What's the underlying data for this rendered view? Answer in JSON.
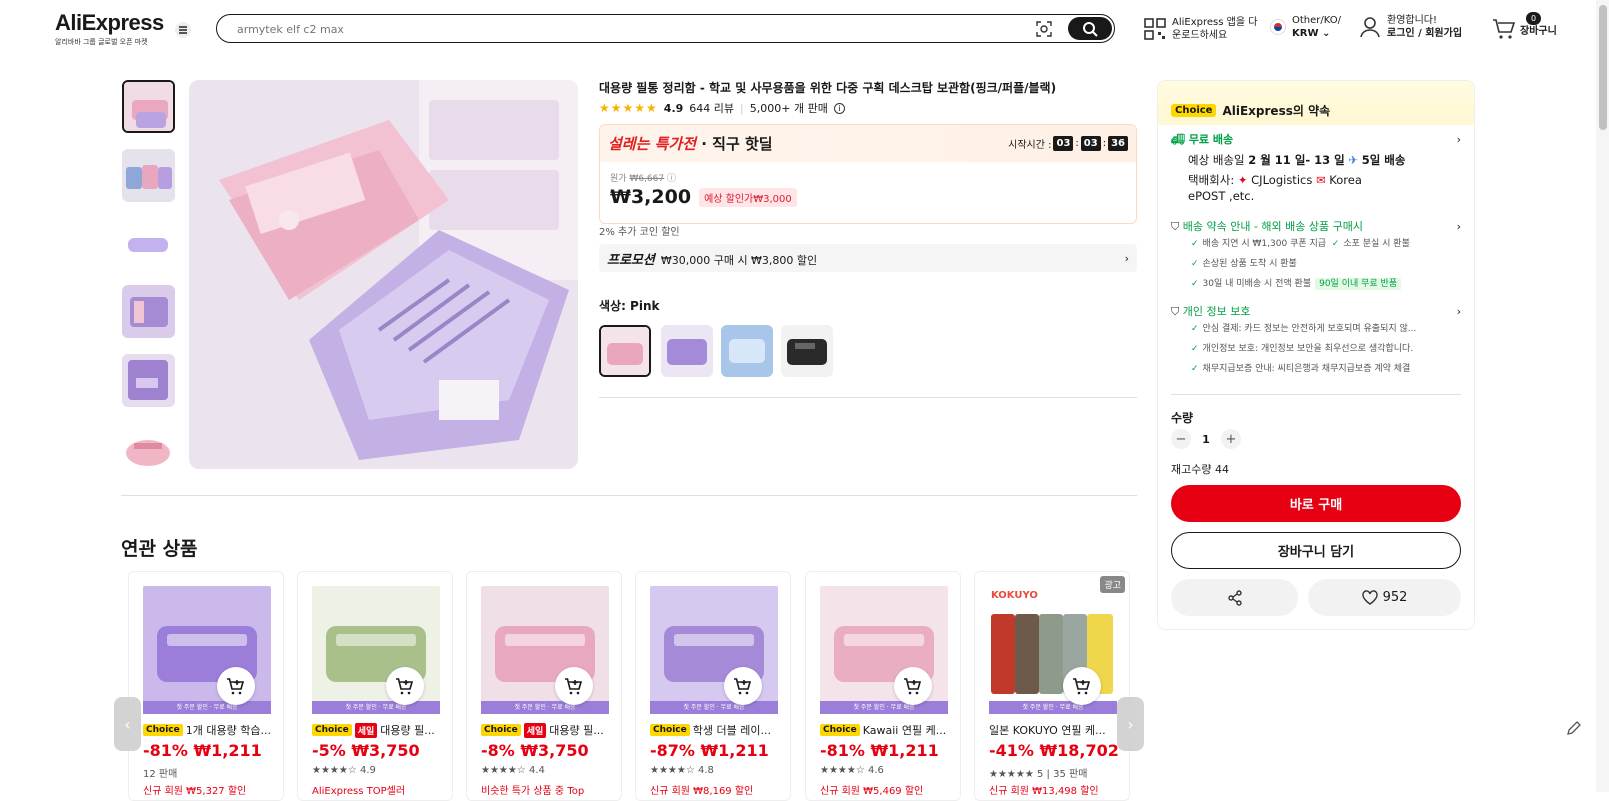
{
  "header": {
    "logo": "AliExpress",
    "logo_sub": "알리바바 그룹 글로벌 오픈 마켓",
    "search_placeholder": "armytek elf c2 max",
    "app_line1": "AliExpress 앱을 다",
    "app_line2": "운로드하세요",
    "region_line1": "Other/KO/",
    "region_line2": "KRW",
    "user_line1": "환영합니다!",
    "user_line2": "로그인 / 회원가입",
    "cart_count": "0",
    "cart_label": "장바구니"
  },
  "product": {
    "title": "대용량 필통 정리함 - 학교 및 사무용품을 위한 다중 구획 데스크탑 보관함(핑크/퍼플/블랙)",
    "rating": "4.9",
    "reviews": "644 리뷰",
    "sold": "5,000+ 개 판매",
    "deal_title_red": "설레는 특가전",
    "deal_title_rest": "· 직구 핫딜",
    "timer_label": "시작시간 :",
    "timer_h": "03",
    "timer_m": "03",
    "timer_s": "36",
    "orig_label": "원가",
    "orig_price": "₩6,667",
    "price": "₩3,200",
    "discount_pill": "예상 할인가₩3,000",
    "coin_text": "2% 추가 코인 할인",
    "promo_label": "프로모션",
    "promo_text": "₩30,000 구매 시 ₩3,800 할인",
    "color_label": "색상: Pink"
  },
  "panel": {
    "choice_badge": "Choice",
    "choice_title": "AliExpress의 약속",
    "free_ship": "무료 배송",
    "delivery_pre": "예상 배송일",
    "delivery_dates": "2 월 11 일- 13 일",
    "delivery_days": "5일 배송",
    "courier_label": "택배회사:",
    "courier1": "CJLogistics",
    "courier2": "Korea",
    "courier3": "ePOST ,etc.",
    "guarantee_title": "배송 약속 안내 - 해외 배송 상품 구매시",
    "g1": "배송 지연 시 ₩1,300 쿠폰 지급",
    "g2": "소포 분실 시 환불",
    "g3": "손상된 상품 도착 시 환불",
    "g4": "30일 내 미배송 시 전액 환불",
    "g4_tag": "90일 이내 무료 반품",
    "privacy_title": "개인 정보 보호",
    "p1": "안심 결제: 카드 정보는 안전하게 보호되며 유출되지 않...",
    "p2": "개인정보 보호: 개인정보 보안을 최우선으로 생각합니다.",
    "p3": "채무지급보증 안내: 씨티은행과 채무지급보증 계약 체결",
    "qty_label": "수량",
    "qty_value": "1",
    "stock": "재고수량 44",
    "buy_now": "바로 구매",
    "add_cart": "장바구니 담기",
    "wish_count": "952"
  },
  "related": {
    "title": "연관 상품",
    "band_text": "첫 주문 할인 · 무료 배송",
    "ad_label": "광고",
    "items": [
      {
        "badge": "Choice",
        "sale": "",
        "name": "1개 대용량 학습...",
        "price": "-81% ₩1,211",
        "sub": "12 판매",
        "promo": "신규 회원 ₩5,327 할인"
      },
      {
        "badge": "Choice",
        "sale": "세일",
        "name": "대용량 필...",
        "price": "-5% ₩3,750",
        "sub": "★★★★☆ 4.9",
        "promo": "AliExpress TOP셀러"
      },
      {
        "badge": "Choice",
        "sale": "세일",
        "name": "대용량 필...",
        "price": "-8% ₩3,750",
        "sub": "★★★★☆ 4.4",
        "promo": "비슷한 특가 상품 중 Top"
      },
      {
        "badge": "Choice",
        "sale": "",
        "name": "학생 더블 레이...",
        "price": "-87% ₩1,211",
        "sub": "★★★★☆ 4.8",
        "promo": "신규 회원 ₩8,169 할인"
      },
      {
        "badge": "Choice",
        "sale": "",
        "name": "Kawaii 연필 케...",
        "price": "-81% ₩1,211",
        "sub": "★★★★☆ 4.6",
        "promo": "신규 회원 ₩5,469 할인"
      },
      {
        "badge": "",
        "sale": "",
        "name": "일본 KOKUYO 연필 케...",
        "price": "-41% ₩18,702",
        "sub": "★★★★★ 5 | 35 판매",
        "promo": "신규 회원 ₩13,498 할인"
      }
    ]
  },
  "colors": {
    "accent": "#e60012",
    "choice": "#ffd700",
    "green": "#00a046"
  }
}
